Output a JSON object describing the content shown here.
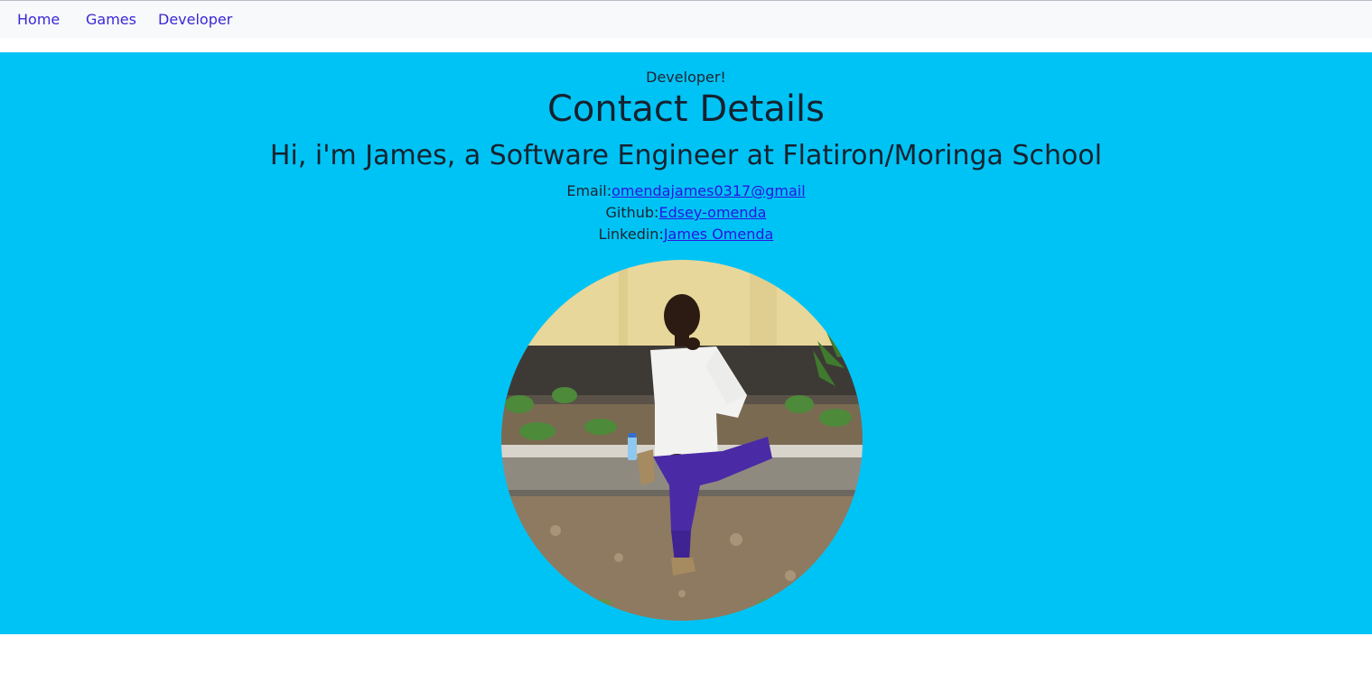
{
  "nav": {
    "items": [
      {
        "label": "Home"
      },
      {
        "label": "Games"
      },
      {
        "label": "Developer"
      }
    ]
  },
  "hero": {
    "subtitle": "Developer!",
    "title": "Contact Details",
    "intro": "Hi, i'm James, a Software Engineer at Flatiron/Moringa School",
    "contacts": {
      "email": {
        "label": "Email:",
        "value": "omendajames0317@gmail"
      },
      "github": {
        "label": "Github:",
        "value": "Edsey-omenda"
      },
      "linkedin": {
        "label": "Linkedin:",
        "value": "James Omenda"
      }
    },
    "background_color": "#00c3f5",
    "link_color": "#2a14e0"
  }
}
